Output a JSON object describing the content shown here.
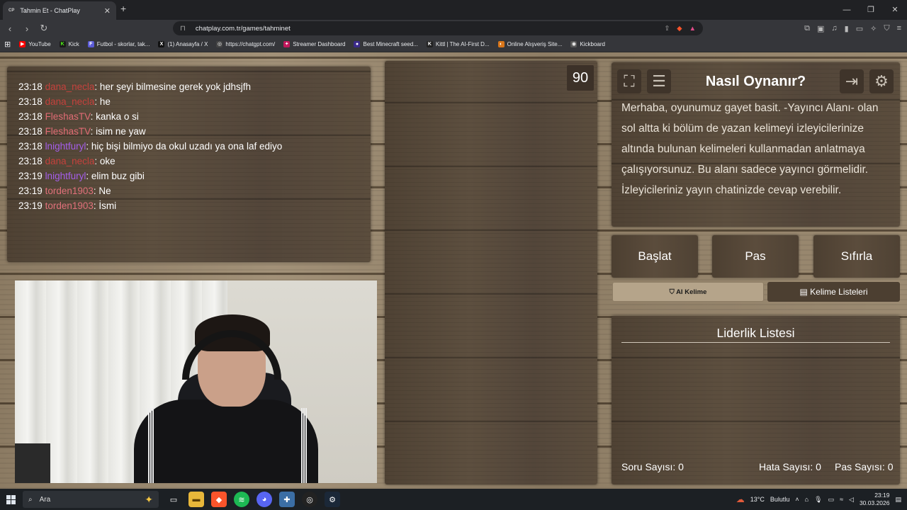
{
  "browser": {
    "tab_title": "Tahmin Et - ChatPlay",
    "tab_favicon": "CP",
    "url": "chatplay.com.tr/games/tahminet",
    "bookmarks": [
      {
        "label": "YouTube",
        "icon": "youtube-icon",
        "color": "#ff0000",
        "glyph": "▶"
      },
      {
        "label": "Kick",
        "icon": "kick-icon",
        "color": "#1a1a1a",
        "glyph": "K"
      },
      {
        "label": "Futbol - skorlar, tak...",
        "icon": "futbol-icon",
        "color": "#5b5bd6",
        "glyph": "F"
      },
      {
        "label": "(1) Anasayfa / X",
        "icon": "x-icon",
        "color": "#111111",
        "glyph": "X"
      },
      {
        "label": "https://chatgpt.com/",
        "icon": "chatgpt-icon",
        "color": "#444444",
        "glyph": "◎"
      },
      {
        "label": "Streamer Dashboard",
        "icon": "streamer-icon",
        "color": "#c2185b",
        "glyph": "✦"
      },
      {
        "label": "Best Minecraft seed...",
        "icon": "minecraft-icon",
        "color": "#3b2a8a",
        "glyph": "●"
      },
      {
        "label": "Kittl | The AI-First D...",
        "icon": "kittl-icon",
        "color": "#222222",
        "glyph": "K"
      },
      {
        "label": "Online Alışveriş Site...",
        "icon": "shopping-icon",
        "color": "#d9761a",
        "glyph": "◐"
      },
      {
        "label": "Kickboard",
        "icon": "kickboard-icon",
        "color": "#555555",
        "glyph": "◉"
      }
    ]
  },
  "chat": {
    "messages": [
      {
        "time": "23:18",
        "user": "dana_necla",
        "user_color": "#c4413c",
        "text": ": her şeyi bilmesine gerek yok jdhsjfh"
      },
      {
        "time": "23:18",
        "user": "dana_necla",
        "user_color": "#c4413c",
        "text": ": he"
      },
      {
        "time": "23:18",
        "user": "FleshasTV",
        "user_color": "#e06b74",
        "text": ": kanka o si"
      },
      {
        "time": "23:18",
        "user": "FleshasTV",
        "user_color": "#e06b74",
        "text": ": isim ne yaw"
      },
      {
        "time": "23:18",
        "user": "lnightfuryl",
        "user_color": "#a45dea",
        "text": ": hiç bişi bilmiyo da okul uzadı ya ona laf ediyo"
      },
      {
        "time": "23:18",
        "user": "dana_necla",
        "user_color": "#c4413c",
        "text": ": oke"
      },
      {
        "time": "23:19",
        "user": "lnightfuryl",
        "user_color": "#a45dea",
        "text": ": elim buz gibi"
      },
      {
        "time": "23:19",
        "user": "torden1903",
        "user_color": "#e0707a",
        "text": ": Ne"
      },
      {
        "time": "23:19",
        "user": "torden1903",
        "user_color": "#e0707a",
        "text": ": İsmi"
      }
    ]
  },
  "game": {
    "timer": "90",
    "info_title": "Nasıl Oynanır?",
    "info_text": "Merhaba, oyunumuz gayet basit. -Yayıncı Alanı- olan sol altta ki bölüm de yazan kelimeyi izleyicilerinize altında bulunan kelimeleri kullanmadan anlatmaya çalışıyorsunuz. Bu alanı sadece yayıncı görmelidir. İzleyicileriniz yayın chatinizde cevap verebilir.",
    "buttons": {
      "start": "Başlat",
      "pass": "Pas",
      "reset": "Sıfırla"
    },
    "ai_word": "AI Kelime",
    "word_lists": "Kelime Listeleri",
    "leaderboard_title": "Liderlik Listesi",
    "stats": {
      "questions": "Soru Sayısı: 0",
      "errors": "Hata Sayısı: 0",
      "passes": "Pas Sayısı: 0"
    }
  },
  "taskbar": {
    "search_placeholder": "Ara",
    "weather": "13°C",
    "weather_desc": "Bulutlu",
    "time": "23:19",
    "date": "30.03.2026"
  }
}
